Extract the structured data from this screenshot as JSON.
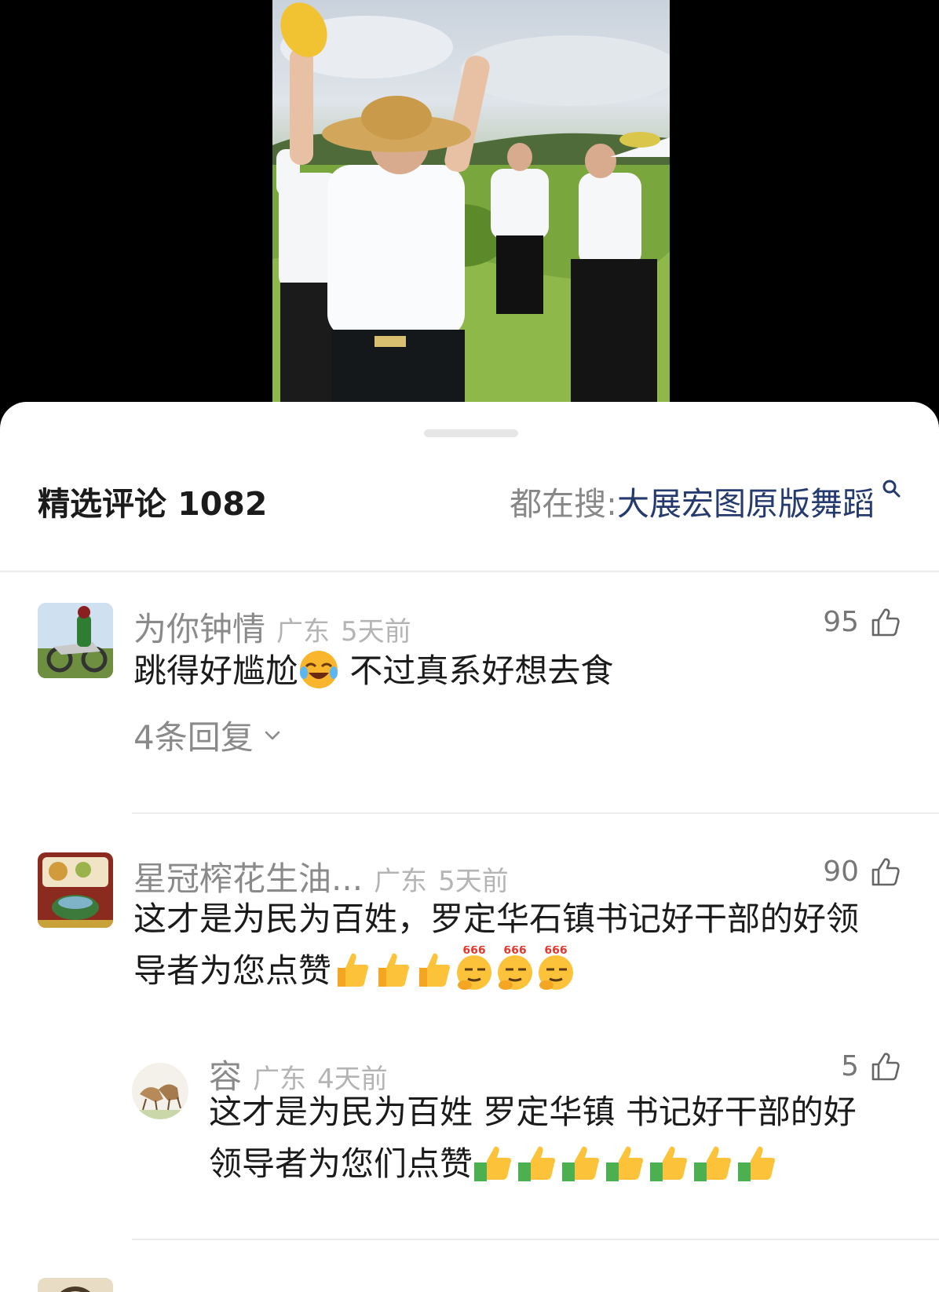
{
  "header": {
    "title": "精选评论 1082",
    "search_prefix": "都在搜: ",
    "search_term": "大展宏图原版舞蹈"
  },
  "comments": [
    {
      "username": "为你钟情",
      "location": "广东",
      "time": "5天前",
      "likes": "95",
      "text_a": "跳得好尴尬",
      "text_b": " 不过真系好想去食",
      "replies_label": "4条回复"
    },
    {
      "username": "星冠榨花生油...",
      "location": "广东",
      "time": "5天前",
      "likes": "90",
      "text_line1": "这才是为民为百姓，罗定华石镇书记好干部的好领",
      "text_line2": "导者为您点赞"
    },
    {
      "username": "容",
      "location": "广东",
      "time": "4天前",
      "likes": "5",
      "text_line1": "这才是为民为百姓 罗定华镇 书记好干部的好",
      "text_line2": "领导者为您们点赞"
    }
  ],
  "icons": {
    "like": "thumbs-up-outline-icon",
    "search": "search-icon",
    "chevron": "chevron-down-icon",
    "emoji_laugh_cry": "rolling-laughing-emoji",
    "emoji_thumbs": "thumbs-up-emoji",
    "emoji_666": "666-emoji",
    "emoji_money_thumbs": "money-thumbs-up-emoji"
  },
  "colors": {
    "search_term": "#253a6e",
    "muted_text": "#8a8a8a",
    "body_text": "#1b1b1b"
  }
}
